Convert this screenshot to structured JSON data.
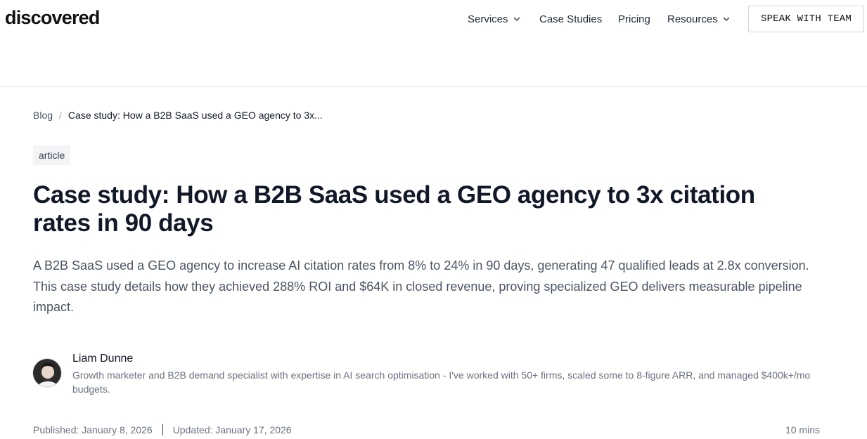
{
  "header": {
    "logo": "discovered",
    "nav": [
      {
        "label": "Services",
        "has_dropdown": true
      },
      {
        "label": "Case Studies",
        "has_dropdown": false
      },
      {
        "label": "Pricing",
        "has_dropdown": false
      },
      {
        "label": "Resources",
        "has_dropdown": true
      }
    ],
    "cta_label": "SPEAK WITH TEAM"
  },
  "breadcrumb": {
    "root": "Blog",
    "separator": "/",
    "current": "Case study: How a B2B SaaS used a GEO agency to 3x..."
  },
  "article": {
    "tag": "article",
    "title": "Case study: How a B2B SaaS used a GEO agency to 3x citation rates in 90 days",
    "lede": "A B2B SaaS used a GEO agency to increase AI citation rates from 8% to 24% in 90 days, generating 47 qualified leads at 2.8x conversion. This case study details how they achieved 288% ROI and $64K in closed revenue, proving specialized GEO delivers measurable pipeline impact."
  },
  "author": {
    "name": "Liam Dunne",
    "bio": "Growth marketer and B2B demand specialist with expertise in AI search optimisation - I've worked with 50+ firms, scaled some to 8-figure ARR, and managed $400k+/mo budgets."
  },
  "meta": {
    "published": "Published: January 8, 2026",
    "updated": "Updated: January 17, 2026",
    "read_time": "10 mins"
  }
}
